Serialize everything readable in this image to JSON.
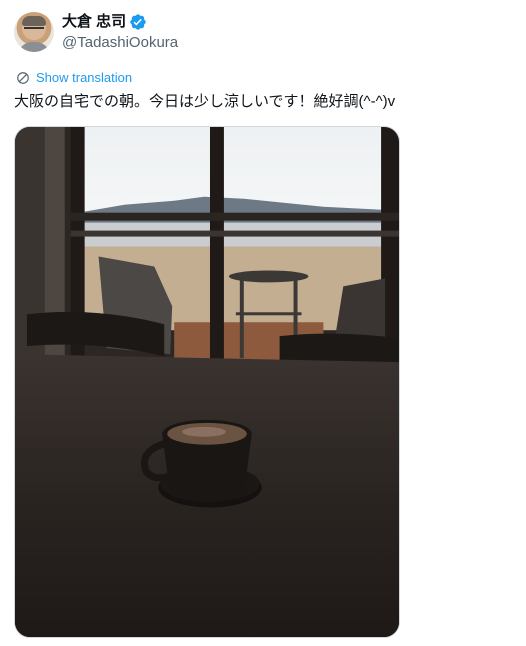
{
  "author": {
    "display_name": "大倉 忠司",
    "handle": "@TadashiOokura",
    "verified": true
  },
  "translate": {
    "label": "Show translation",
    "icon": "globe-translate-icon"
  },
  "tweet": {
    "text": "大阪の自宅での朝。今日は少し涼しいです！絶好調(^-^)v"
  },
  "colors": {
    "accent": "#1d9bf0",
    "text": "#0f1419",
    "secondary": "#536471"
  }
}
